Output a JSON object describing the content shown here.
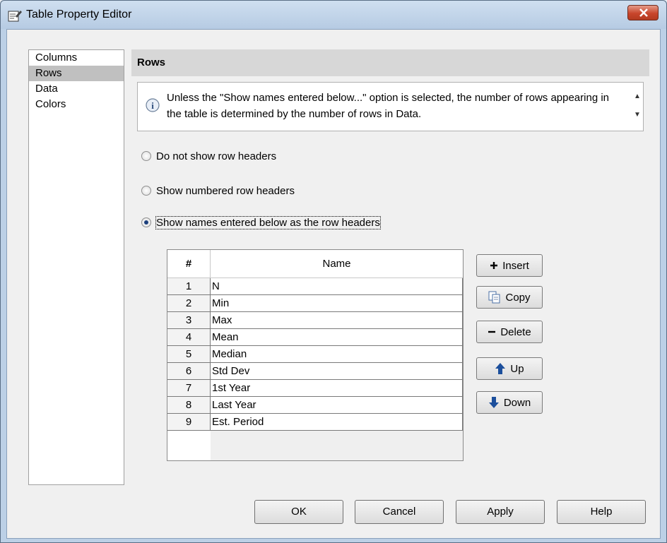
{
  "window": {
    "title": "Table Property Editor"
  },
  "nav": {
    "items": [
      "Columns",
      "Rows",
      "Data",
      "Colors"
    ],
    "selected": "Rows"
  },
  "section": {
    "title": "Rows",
    "info_text": "Unless the \"Show names entered below...\" option is selected, the number of rows appearing in the table is determined by the number of rows in Data."
  },
  "options": [
    {
      "label": "Do not show row headers",
      "checked": false
    },
    {
      "label": "Show numbered row headers",
      "checked": false
    },
    {
      "label": "Show names entered below as the row headers",
      "checked": true
    }
  ],
  "table": {
    "headers": [
      "#",
      "Name"
    ],
    "rows": [
      {
        "num": "1",
        "name": "N"
      },
      {
        "num": "2",
        "name": "Min"
      },
      {
        "num": "3",
        "name": "Max"
      },
      {
        "num": "4",
        "name": "Mean"
      },
      {
        "num": "5",
        "name": "Median"
      },
      {
        "num": "6",
        "name": "Std Dev"
      },
      {
        "num": "7",
        "name": "1st Year"
      },
      {
        "num": "8",
        "name": "Last Year"
      },
      {
        "num": "9",
        "name": "Est. Period"
      }
    ]
  },
  "side_buttons": {
    "insert": "Insert",
    "copy": "Copy",
    "delete": "Delete",
    "up": "Up",
    "down": "Down"
  },
  "dialog_buttons": {
    "ok": "OK",
    "cancel": "Cancel",
    "apply": "Apply",
    "help": "Help"
  },
  "colors": {
    "titlebar": "#bcd0e6",
    "close": "#c8452b",
    "selected": "#c0c0c0",
    "arrow": "#1c4f9c"
  }
}
